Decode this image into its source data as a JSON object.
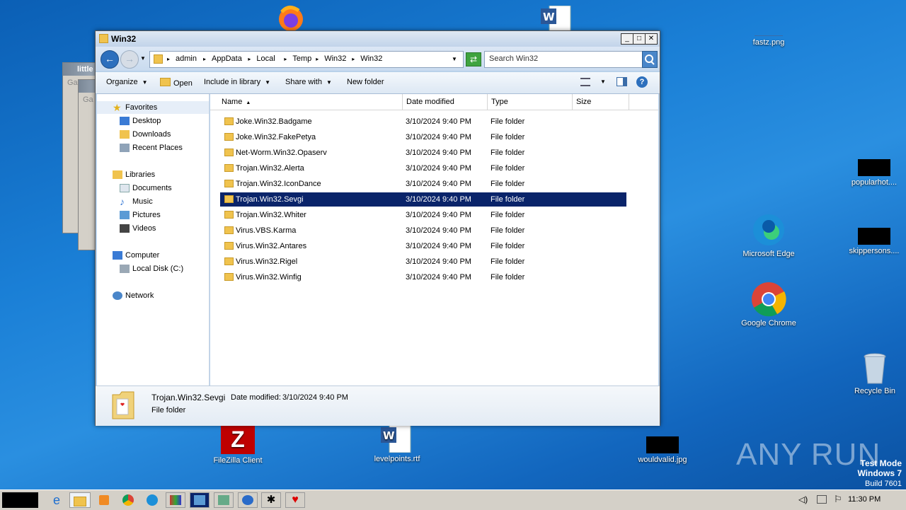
{
  "desktop": {
    "icons": {
      "fastz": "fastz.png",
      "popularhot": "popularhot....",
      "edge": "Microsoft Edge",
      "skipperson": "skippersons....",
      "chrome": "Google Chrome",
      "recycle": "Recycle Bin",
      "filezilla": "FileZilla Client",
      "levelpoints": "levelpoints.rtf",
      "wouldvalid": "wouldvalid.jpg"
    },
    "bg_window_title": "little",
    "bg_window_sub": "Ga",
    "watermark": {
      "anyrun": "ANY RUN",
      "mode": "Test Mode",
      "os": "Windows 7",
      "build": "Build 7601"
    }
  },
  "explorer": {
    "title": "Win32",
    "breadcrumb": [
      "admin",
      "AppData",
      "Local",
      "Temp",
      "Win32",
      "Win32"
    ],
    "search_placeholder": "Search Win32",
    "toolbar": {
      "organize": "Organize",
      "open": "Open",
      "include_in_library": "Include in library",
      "share_with": "Share with",
      "new_folder": "New folder"
    },
    "nav": {
      "favorites": "Favorites",
      "desktop": "Desktop",
      "downloads": "Downloads",
      "recent": "Recent Places",
      "libraries": "Libraries",
      "documents": "Documents",
      "music": "Music",
      "pictures": "Pictures",
      "videos": "Videos",
      "computer": "Computer",
      "local_disk": "Local Disk (C:)",
      "network": "Network"
    },
    "columns": {
      "name": "Name",
      "date": "Date modified",
      "type": "Type",
      "size": "Size"
    },
    "files": [
      {
        "name": "Joke.Win32.Badgame",
        "date": "3/10/2024 9:40 PM",
        "type": "File folder"
      },
      {
        "name": "Joke.Win32.FakePetya",
        "date": "3/10/2024 9:40 PM",
        "type": "File folder"
      },
      {
        "name": "Net-Worm.Win32.Opaserv",
        "date": "3/10/2024 9:40 PM",
        "type": "File folder"
      },
      {
        "name": "Trojan.Win32.Alerta",
        "date": "3/10/2024 9:40 PM",
        "type": "File folder"
      },
      {
        "name": "Trojan.Win32.IconDance",
        "date": "3/10/2024 9:40 PM",
        "type": "File folder"
      },
      {
        "name": "Trojan.Win32.Sevgi",
        "date": "3/10/2024 9:40 PM",
        "type": "File folder"
      },
      {
        "name": "Trojan.Win32.Whiter",
        "date": "3/10/2024 9:40 PM",
        "type": "File folder"
      },
      {
        "name": "Virus.VBS.Karma",
        "date": "3/10/2024 9:40 PM",
        "type": "File folder"
      },
      {
        "name": "Virus.Win32.Antares",
        "date": "3/10/2024 9:40 PM",
        "type": "File folder"
      },
      {
        "name": "Virus.Win32.Rigel",
        "date": "3/10/2024 9:40 PM",
        "type": "File folder"
      },
      {
        "name": "Virus.Win32.Winfig",
        "date": "3/10/2024 9:40 PM",
        "type": "File folder"
      }
    ],
    "selected_index": 5,
    "details": {
      "name": "Trojan.Win32.Sevgi",
      "date_label": "Date modified:",
      "date_value": "3/10/2024 9:40 PM",
      "type": "File folder"
    }
  },
  "taskbar": {
    "clock": "11:30 PM"
  },
  "colors": {
    "selection": "#0a246a",
    "folder": "#f0c34e"
  }
}
